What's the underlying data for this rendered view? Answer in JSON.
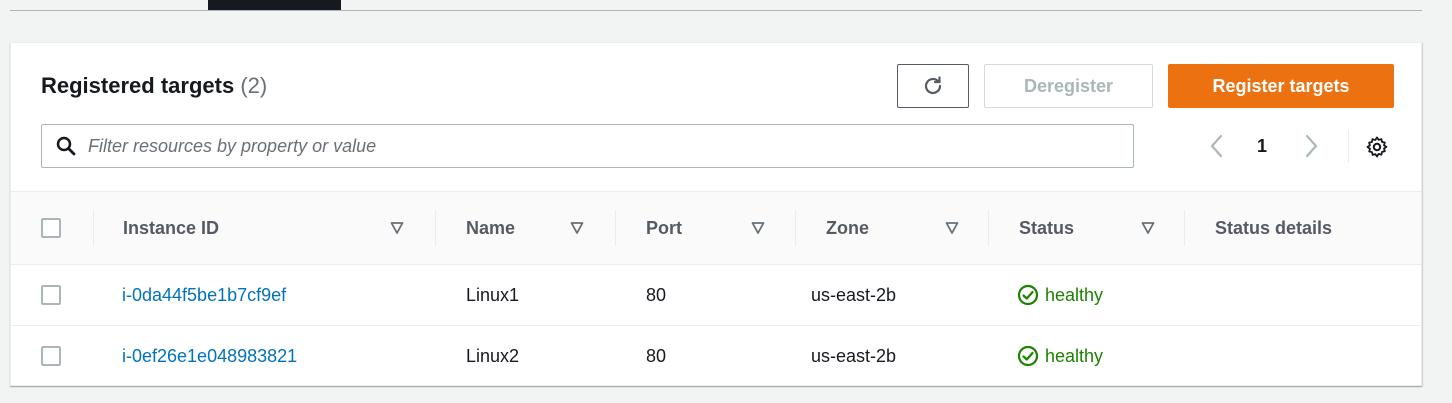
{
  "header": {
    "title": "Registered targets",
    "count": "(2)"
  },
  "toolbar": {
    "refresh_icon": "refresh-icon",
    "deregister_label": "Deregister",
    "register_label": "Register targets",
    "colors": {
      "primary": "#ec7211",
      "disabled_text": "#aab7b8"
    }
  },
  "search": {
    "placeholder": "Filter resources by property or value",
    "value": ""
  },
  "pagination": {
    "current_page": "1",
    "prev_icon": "chevron-left-icon",
    "next_icon": "chevron-right-icon",
    "settings_icon": "gear-icon"
  },
  "table": {
    "columns": [
      {
        "label": "Instance ID",
        "sortable": true
      },
      {
        "label": "Name",
        "sortable": true
      },
      {
        "label": "Port",
        "sortable": true
      },
      {
        "label": "Zone",
        "sortable": true
      },
      {
        "label": "Status",
        "sortable": true
      },
      {
        "label": "Status details",
        "sortable": false
      }
    ],
    "rows": [
      {
        "instance_id": "i-0da44f5be1b7cf9ef",
        "name": "Linux1",
        "port": "80",
        "zone": "us-east-2b",
        "status": "healthy",
        "status_details": ""
      },
      {
        "instance_id": "i-0ef26e1e048983821",
        "name": "Linux2",
        "port": "80",
        "zone": "us-east-2b",
        "status": "healthy",
        "status_details": ""
      }
    ],
    "colors": {
      "link": "#0073bb",
      "healthy": "#1d8102"
    }
  }
}
